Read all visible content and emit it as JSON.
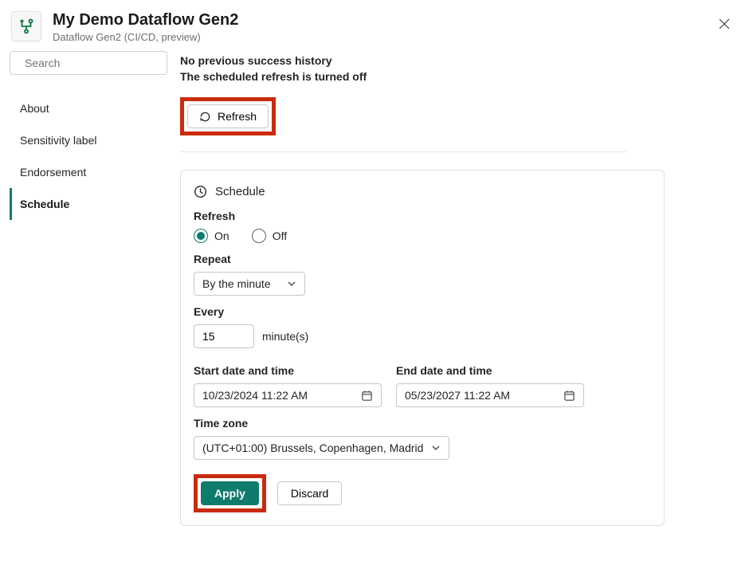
{
  "header": {
    "title": "My Demo Dataflow Gen2",
    "subtitle": "Dataflow Gen2 (CI/CD, preview)"
  },
  "sidebar": {
    "search_placeholder": "Search",
    "items": [
      {
        "label": "About"
      },
      {
        "label": "Sensitivity label"
      },
      {
        "label": "Endorsement"
      },
      {
        "label": "Schedule"
      }
    ],
    "active_index": 3
  },
  "main": {
    "status_no_history": "No previous success history",
    "status_refresh_off": "The scheduled refresh is turned off",
    "refresh_button_label": "Refresh"
  },
  "schedule_panel": {
    "title": "Schedule",
    "refresh_label": "Refresh",
    "refresh_on_label": "On",
    "refresh_off_label": "Off",
    "refresh_value": "On",
    "repeat_label": "Repeat",
    "repeat_value": "By the minute",
    "every_label": "Every",
    "every_value": "15",
    "every_unit": "minute(s)",
    "start_label": "Start date and time",
    "start_value": "10/23/2024 11:22 AM",
    "end_label": "End date and time",
    "end_value": "05/23/2027 11:22 AM",
    "timezone_label": "Time zone",
    "timezone_value": "(UTC+01:00) Brussels, Copenhagen, Madrid",
    "apply_label": "Apply",
    "discard_label": "Discard"
  },
  "colors": {
    "accent": "#0f7b6c",
    "highlight_red": "#c92b0f"
  }
}
